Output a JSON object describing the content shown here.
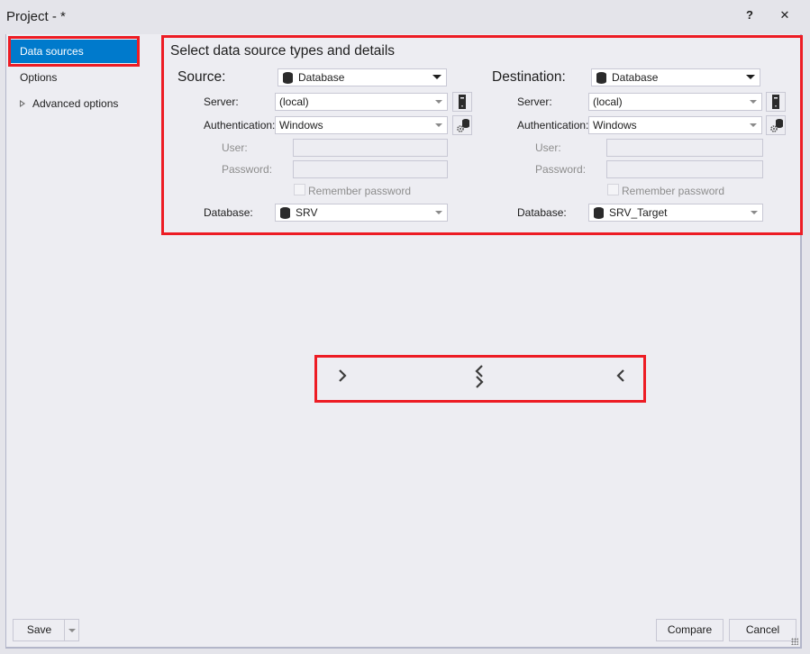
{
  "window": {
    "title": "Project - *",
    "help_label": "?",
    "close_label": "✕"
  },
  "sidebar": {
    "items": [
      {
        "label": "Data sources",
        "active": true
      },
      {
        "label": "Options",
        "active": false
      },
      {
        "label": "Advanced options",
        "active": false,
        "expandable": true
      }
    ]
  },
  "main": {
    "section_title": "Select data source types and details",
    "source": {
      "heading": "Source:",
      "type": "Database",
      "server_label": "Server:",
      "server_value": "(local)",
      "auth_label": "Authentication:",
      "auth_value": "Windows",
      "user_label": "User:",
      "user_value": "",
      "password_label": "Password:",
      "password_value": "",
      "remember_label": "Remember password",
      "remember_checked": false,
      "database_label": "Database:",
      "database_value": "SRV"
    },
    "destination": {
      "heading": "Destination:",
      "type": "Database",
      "server_label": "Server:",
      "server_value": "(local)",
      "auth_label": "Authentication:",
      "auth_value": "Windows",
      "user_label": "User:",
      "user_value": "",
      "password_label": "Password:",
      "password_value": "",
      "remember_label": "Remember password",
      "remember_checked": false,
      "database_label": "Database:",
      "database_value": "SRV_Target"
    },
    "copy_controls": {
      "icons": [
        "copy-right-icon",
        "swap-icon",
        "copy-left-icon"
      ]
    }
  },
  "footer": {
    "save_label": "Save",
    "compare_label": "Compare",
    "cancel_label": "Cancel"
  },
  "colors": {
    "accent": "#007acc",
    "highlight_box": "#ed1c24"
  }
}
